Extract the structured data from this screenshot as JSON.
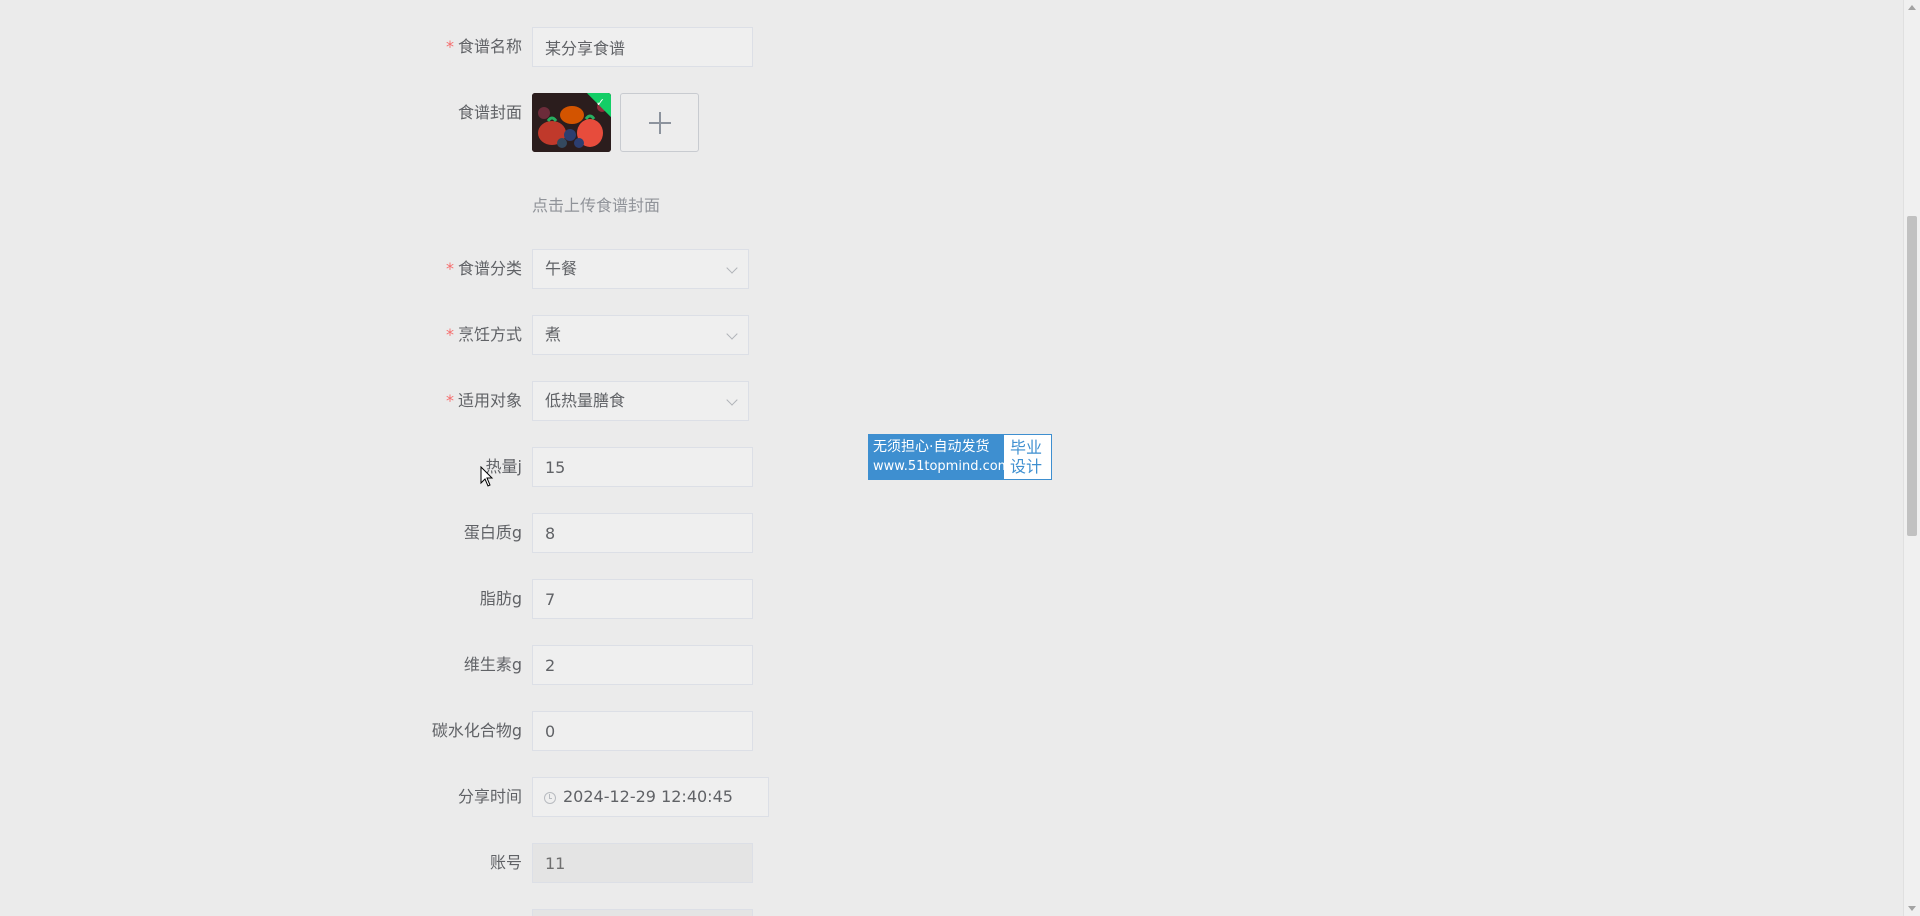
{
  "form": {
    "recipe_name": {
      "label": "食谱名称",
      "required": true,
      "value": "某分享食谱"
    },
    "cover": {
      "label": "食谱封面",
      "required": false,
      "upload_hint": "点击上传食谱封面"
    },
    "category": {
      "label": "食谱分类",
      "required": true,
      "value": "午餐"
    },
    "cooking_method": {
      "label": "烹饪方式",
      "required": true,
      "value": "煮"
    },
    "audience": {
      "label": "适用对象",
      "required": true,
      "value": "低热量膳食"
    },
    "calories": {
      "label": "热量j",
      "required": false,
      "value": "15"
    },
    "protein": {
      "label": "蛋白质g",
      "required": false,
      "value": "8"
    },
    "fat": {
      "label": "脂肪g",
      "required": false,
      "value": "7"
    },
    "vitamin": {
      "label": "维生素g",
      "required": false,
      "value": "2"
    },
    "carbs": {
      "label": "碳水化合物g",
      "required": false,
      "value": "0"
    },
    "share_time": {
      "label": "分享时间",
      "required": false,
      "value": "2024-12-29 12:40:45"
    },
    "account": {
      "label": "账号",
      "required": false,
      "value": "11"
    }
  },
  "required_mark": "*",
  "watermark": {
    "line1": "无须担心·自动发货",
    "line2": "www.51topmind.com",
    "side1": "毕业",
    "side2": "设计"
  },
  "icons": {
    "upload": "plus-icon",
    "uploaded": "check-icon",
    "select": "chevron-down-icon",
    "date": "clock-icon"
  },
  "colors": {
    "background": "#ebebeb",
    "required": "#f56c6c",
    "success": "#13ce66",
    "watermark_blue": "#3e8fd0"
  }
}
